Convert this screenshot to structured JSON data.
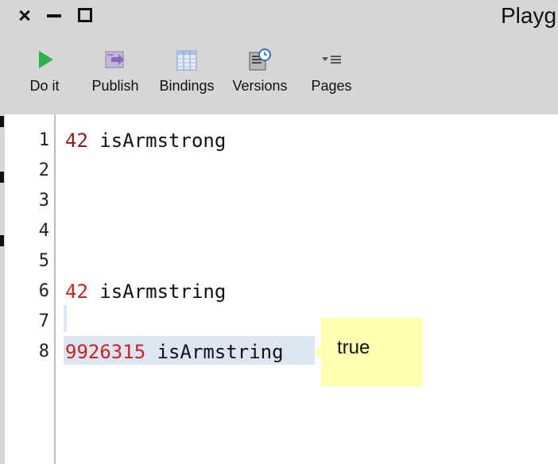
{
  "window": {
    "title": "Playg"
  },
  "toolbar": {
    "buttons": [
      {
        "label": "Do it",
        "icon": "play-icon"
      },
      {
        "label": "Publish",
        "icon": "publish-icon"
      },
      {
        "label": "Bindings",
        "icon": "bindings-icon"
      },
      {
        "label": "Versions",
        "icon": "versions-icon"
      },
      {
        "label": "Pages",
        "icon": "pages-icon"
      }
    ]
  },
  "editor": {
    "line_numbers": [
      "1",
      "2",
      "3",
      "4",
      "5",
      "6",
      "7",
      "8"
    ],
    "lines": [
      {
        "number": "42",
        "message": " isArmstrong"
      },
      {
        "number": "",
        "message": ""
      },
      {
        "number": "",
        "message": ""
      },
      {
        "number": "",
        "message": ""
      },
      {
        "number": "",
        "message": ""
      },
      {
        "number": "42",
        "message": " isArmstring"
      },
      {
        "number": "",
        "message": ""
      },
      {
        "number": "9926315",
        "message": " isArmstring"
      }
    ],
    "result": "true"
  },
  "colors": {
    "chrome_bg": "#d6d6d6",
    "number_literal": "#8b1a1a",
    "number_literal_active": "#d41f1f",
    "selection": "#dce6f2",
    "result_popup": "#ffffb0",
    "play_green": "#2db34a",
    "publish_purple": "#9b7bc4"
  }
}
